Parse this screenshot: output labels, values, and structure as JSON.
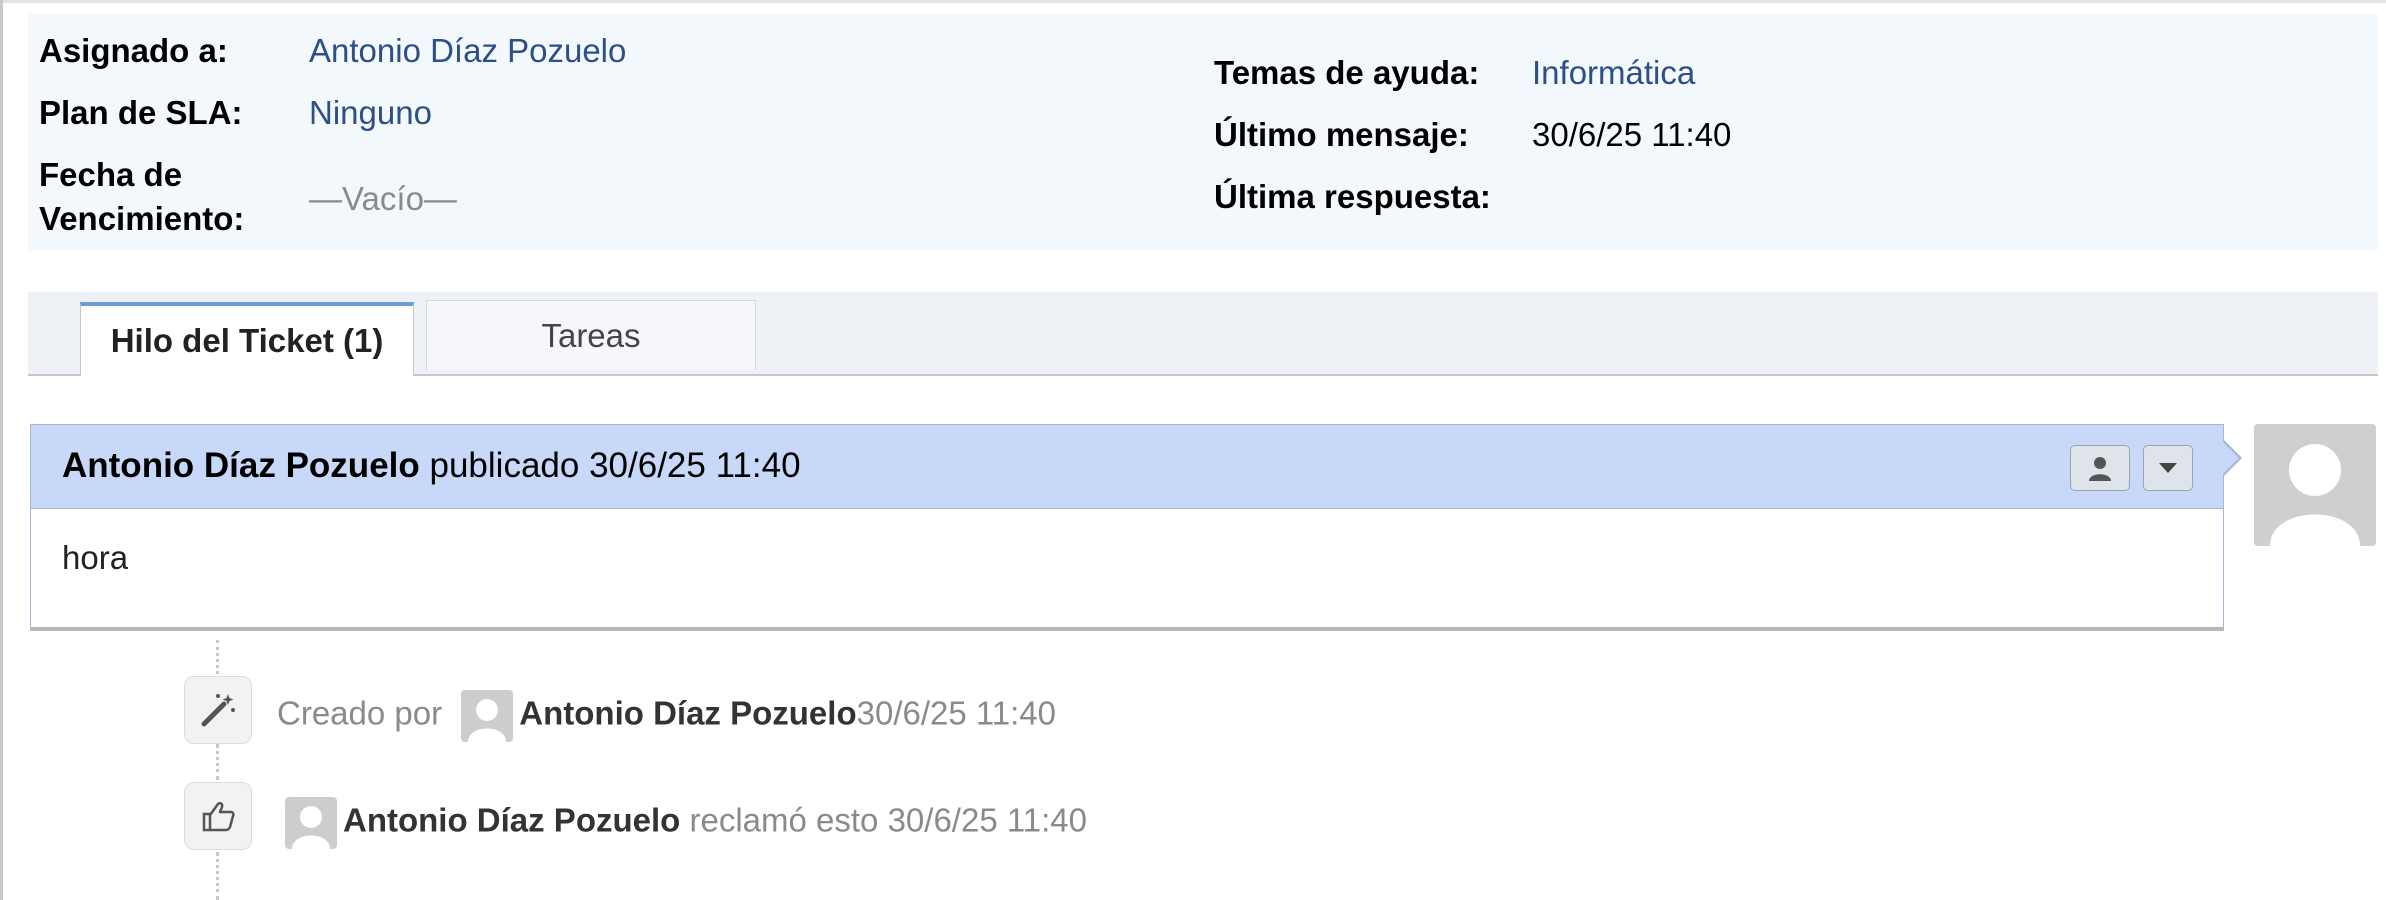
{
  "ticket_info": {
    "assigned_label": "Asignado a:",
    "assigned_value": "Antonio Díaz Pozuelo",
    "sla_label": "Plan de SLA:",
    "sla_value": "Ninguno",
    "due_label_line1": "Fecha de",
    "due_label_line2": "Vencimiento:",
    "due_value": "—Vacío—",
    "help_topic_label": "Temas de ayuda:",
    "help_topic_value": "Informática",
    "last_message_label": "Último mensaje:",
    "last_message_value": "30/6/25 11:40",
    "last_response_label": "Última respuesta:",
    "last_response_value": ""
  },
  "tabs": [
    {
      "label": "Hilo del Ticket (1)",
      "active": true
    },
    {
      "label": "Tareas",
      "active": false
    }
  ],
  "thread": {
    "author": "Antonio Díaz Pozuelo",
    "posted_text": "publicado 30/6/25 11:40",
    "body": "hora",
    "header_color": "#c8d8f8"
  },
  "events": [
    {
      "icon": "magic-wand-icon",
      "prefix": "Creado por",
      "user": "Antonio Díaz Pozuelo",
      "suffix": "30/6/25 11:40"
    },
    {
      "icon": "thumbs-up-icon",
      "prefix": "",
      "user": "Antonio Díaz Pozuelo",
      "suffix": "reclamó esto 30/6/25 11:40"
    }
  ],
  "colors": {
    "link": "#2c4f86",
    "panel_bg": "#f3f8fd",
    "tab_active_border": "#6e9bd6"
  }
}
